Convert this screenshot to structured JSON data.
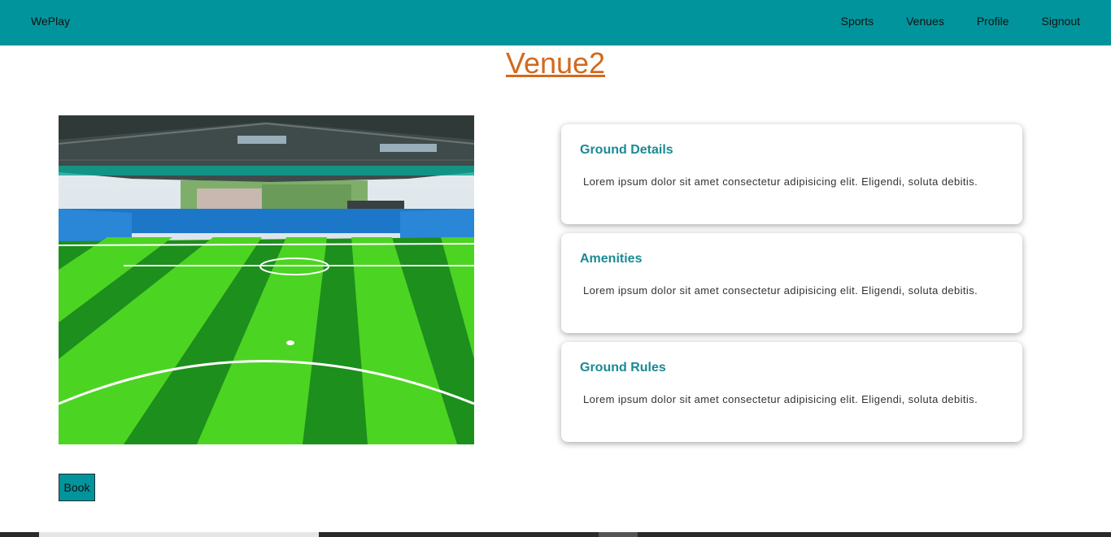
{
  "nav": {
    "brand": "WePlay",
    "links": [
      "Sports",
      "Venues",
      "Profile",
      "Signout"
    ]
  },
  "venue": {
    "title": "Venue2",
    "book_label": "Book"
  },
  "cards": [
    {
      "title": "Ground Details",
      "text": "Lorem ipsum dolor sit amet consectetur adipisicing elit. Eligendi, soluta debitis."
    },
    {
      "title": "Amenities",
      "text": "Lorem ipsum dolor sit amet consectetur adipisicing elit. Eligendi, soluta debitis."
    },
    {
      "title": "Ground Rules",
      "text": "Lorem ipsum dolor sit amet consectetur adipisicing elit. Eligendi, soluta debitis."
    }
  ],
  "colors": {
    "navbar": "#02949c",
    "title": "#d2691e",
    "card_heading": "#1a8a94"
  }
}
